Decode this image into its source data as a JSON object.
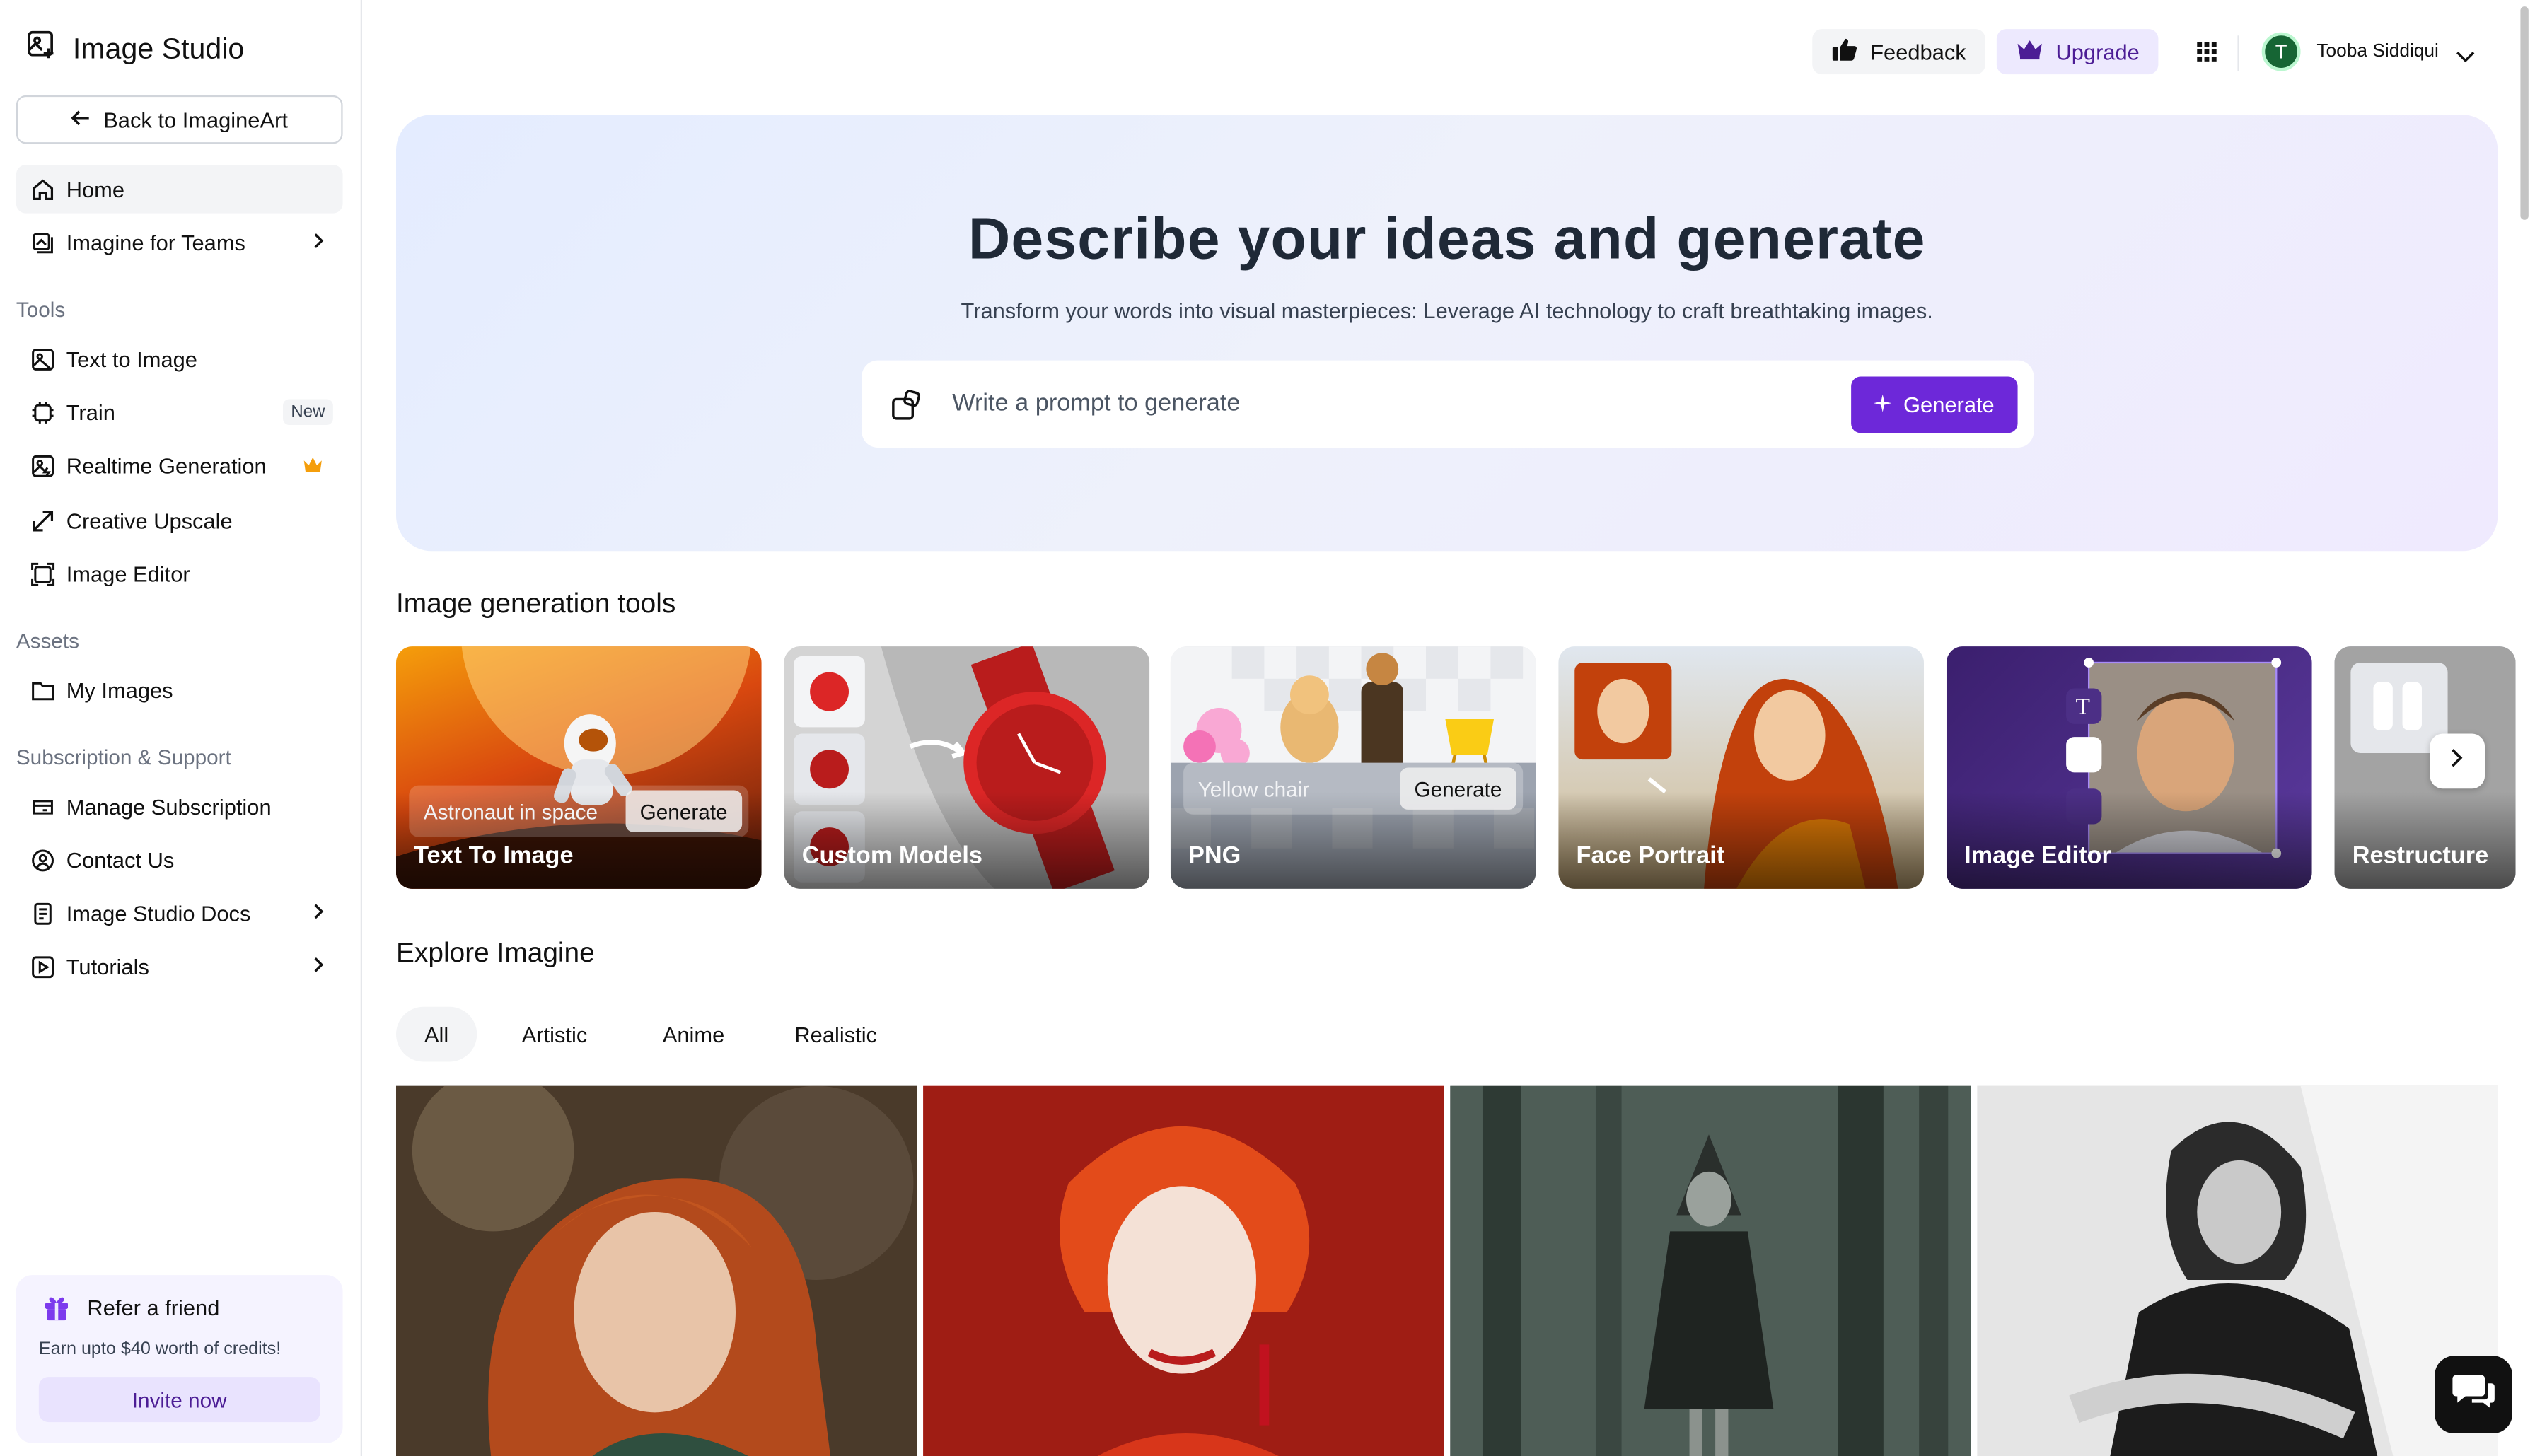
{
  "app": {
    "title": "Image Studio"
  },
  "sidebar": {
    "back_label": "Back to ImagineArt",
    "home": "Home",
    "teams": "Imagine for Teams",
    "tools_heading": "Tools",
    "tools": [
      {
        "label": "Text to Image"
      },
      {
        "label": "Train",
        "badge": "New"
      },
      {
        "label": "Realtime Generation"
      },
      {
        "label": "Creative Upscale"
      },
      {
        "label": "Image Editor"
      }
    ],
    "assets_heading": "Assets",
    "my_images": "My Images",
    "support_heading": "Subscription & Support",
    "support": [
      {
        "label": "Manage Subscription"
      },
      {
        "label": "Contact Us"
      },
      {
        "label": "Image Studio Docs"
      },
      {
        "label": "Tutorials"
      }
    ],
    "refer": {
      "title": "Refer a friend",
      "subtitle": "Earn upto $40 worth of credits!",
      "button": "Invite now"
    }
  },
  "header": {
    "feedback": "Feedback",
    "upgrade": "Upgrade",
    "avatar_initial": "T",
    "user_name": "Tooba Siddiqui"
  },
  "hero": {
    "title": "Describe your ideas and generate",
    "subtitle": "Transform your words into visual masterpieces: Leverage AI technology to craft breathtaking images.",
    "prompt_placeholder": "Write a prompt to generate",
    "generate": "Generate"
  },
  "tools_section": {
    "heading": "Image generation tools",
    "cards": [
      {
        "label": "Text To Image",
        "prompt": "Astronaut in space",
        "button": "Generate"
      },
      {
        "label": "Custom Models"
      },
      {
        "label": "PNG",
        "prompt": "Yellow chair",
        "button": "Generate"
      },
      {
        "label": "Face Portrait"
      },
      {
        "label": "Image Editor"
      },
      {
        "label": "Restructure"
      }
    ]
  },
  "explore": {
    "heading": "Explore Imagine",
    "tabs": [
      "All",
      "Artistic",
      "Anime",
      "Realistic"
    ],
    "active_tab": "All"
  },
  "colors": {
    "accent": "#6d28d9",
    "hero_start": "#e4ecff",
    "hero_end": "#efeafe"
  }
}
